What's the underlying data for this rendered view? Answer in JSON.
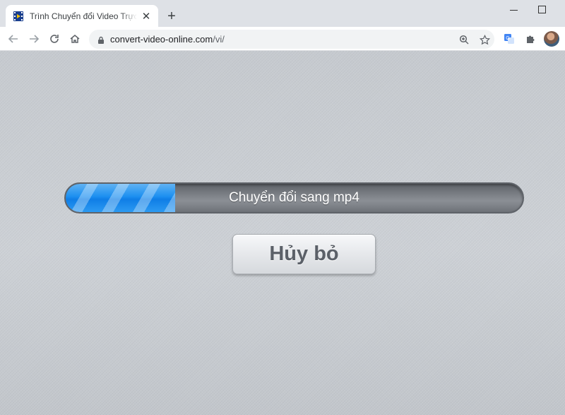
{
  "browser": {
    "tab": {
      "title": "Trình Chuyển đổi Video Trực tuyến"
    },
    "url": {
      "host": "convert-video-online.com",
      "path": "/vi/"
    }
  },
  "converter": {
    "progress_label": "Chuyển đổi sang mp4",
    "progress_percent": 24,
    "cancel_label": "Hủy bỏ"
  },
  "icons": {
    "tab_favicon": "film-strip-icon",
    "tab_close": "close-icon",
    "new_tab": "plus-icon",
    "back": "arrow-left-icon",
    "forward": "arrow-right-icon",
    "reload": "reload-icon",
    "home": "home-icon",
    "lock": "lock-icon",
    "zoom": "zoom-icon",
    "bookmark": "star-icon",
    "translate": "google-translate-icon",
    "extensions": "puzzle-icon"
  },
  "colors": {
    "progress_fill": "#1c8ff0",
    "progress_track": "#7d8187",
    "page_background": "#c9cdd2"
  }
}
